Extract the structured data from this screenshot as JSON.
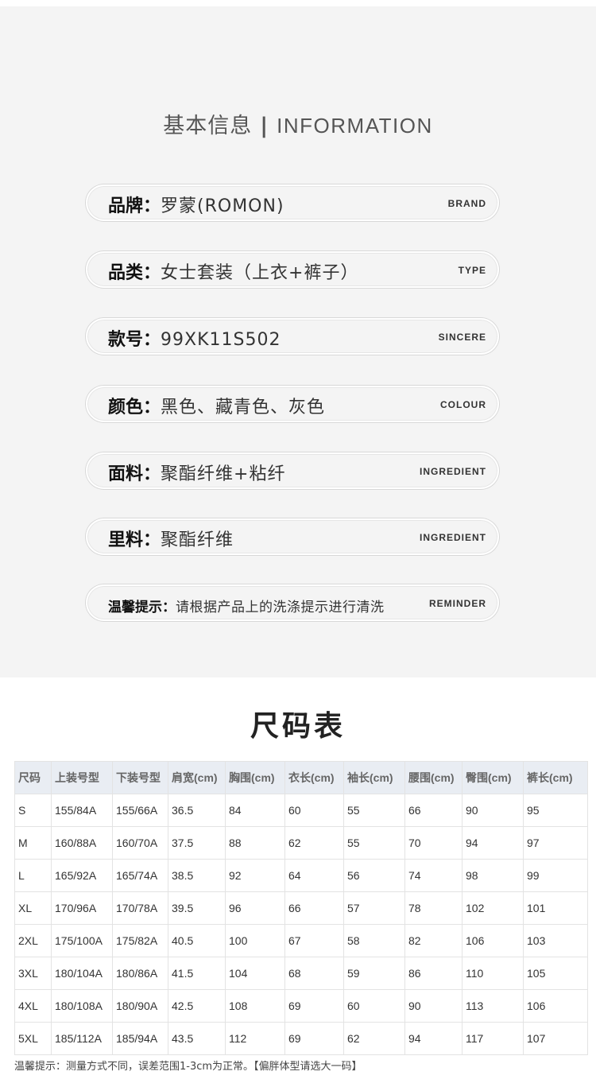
{
  "info": {
    "title_cn": "基本信息",
    "title_sep": "|",
    "title_en": "INFORMATION",
    "rows": [
      {
        "label": "品牌：",
        "value": "罗蒙(ROMON)",
        "en": "BRAND"
      },
      {
        "label": "品类：",
        "value": "女士套装（上衣+裤子）",
        "en": "TYPE"
      },
      {
        "label": "款号：",
        "value": "99XK11S502",
        "en": "SINCERE"
      },
      {
        "label": "颜色：",
        "value": "黑色、藏青色、灰色",
        "en": "COLOUR"
      },
      {
        "label": "面料：",
        "value": "聚酯纤维+粘纤",
        "en": "INGREDIENT"
      },
      {
        "label": "里料：",
        "value": "聚酯纤维",
        "en": "INGREDIENT"
      },
      {
        "label": "温馨提示：",
        "value": "请根据产品上的洗涤提示进行清洗",
        "en": "REMINDER"
      }
    ]
  },
  "size_chart": {
    "title": "尺码表",
    "headers": [
      "尺码",
      "上装号型",
      "下装号型",
      "肩宽(cm)",
      "胸围(cm)",
      "衣长(cm)",
      "袖长(cm)",
      "腰围(cm)",
      "臀围(cm)",
      "裤长(cm)"
    ],
    "rows": [
      [
        "S",
        "155/84A",
        "155/66A",
        "36.5",
        "84",
        "60",
        "55",
        "66",
        "90",
        "95"
      ],
      [
        "M",
        "160/88A",
        "160/70A",
        "37.5",
        "88",
        "62",
        "55",
        "70",
        "94",
        "97"
      ],
      [
        "L",
        "165/92A",
        "165/74A",
        "38.5",
        "92",
        "64",
        "56",
        "74",
        "98",
        "99"
      ],
      [
        "XL",
        "170/96A",
        "170/78A",
        "39.5",
        "96",
        "66",
        "57",
        "78",
        "102",
        "101"
      ],
      [
        "2XL",
        "175/100A",
        "175/82A",
        "40.5",
        "100",
        "67",
        "58",
        "82",
        "106",
        "103"
      ],
      [
        "3XL",
        "180/104A",
        "180/86A",
        "41.5",
        "104",
        "68",
        "59",
        "86",
        "110",
        "105"
      ],
      [
        "4XL",
        "180/108A",
        "180/90A",
        "42.5",
        "108",
        "69",
        "60",
        "90",
        "113",
        "106"
      ],
      [
        "5XL",
        "185/112A",
        "185/94A",
        "43.5",
        "112",
        "69",
        "62",
        "94",
        "117",
        "107"
      ]
    ],
    "footnote": "温馨提示：测量方式不同，误差范围1-3cm为正常。【偏胖体型请选大一码】"
  }
}
